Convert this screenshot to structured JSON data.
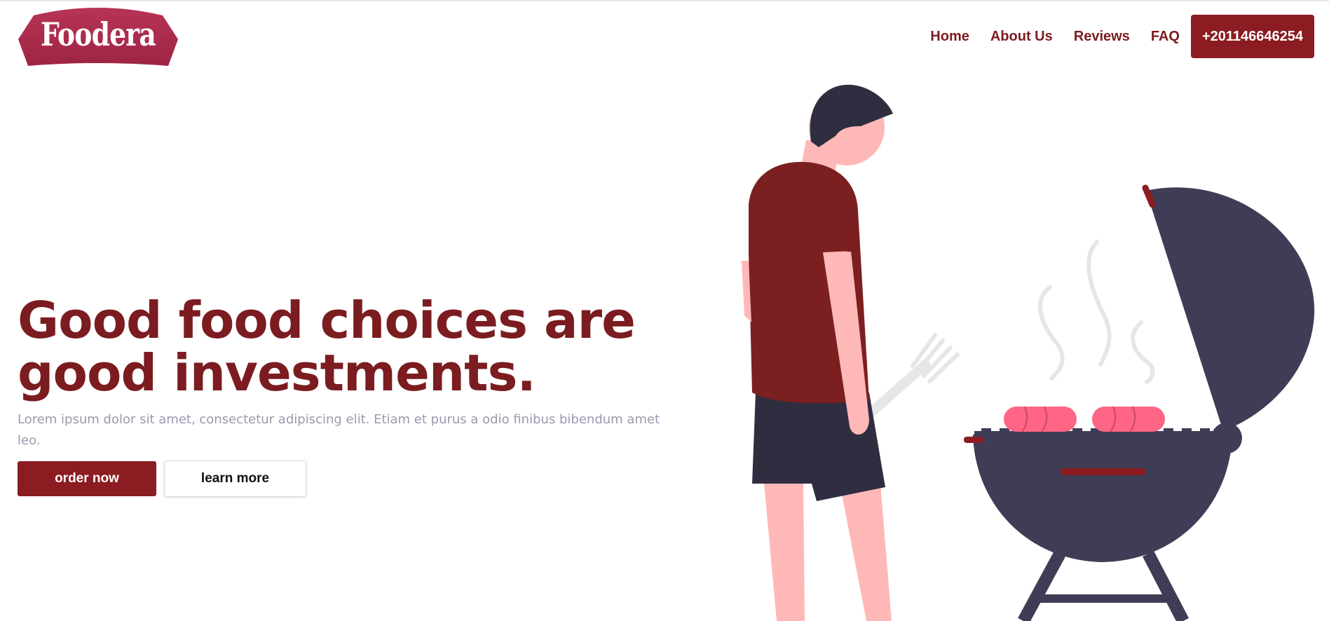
{
  "brand": {
    "name": "Foodera",
    "color": "#a82a49"
  },
  "nav": {
    "links": [
      "Home",
      "About Us",
      "Reviews",
      "FAQ"
    ],
    "phone": "+201146646254"
  },
  "hero": {
    "title": "Good food choices are good investments.",
    "subtitle": "Lorem ipsum dolor sit amet, consectetur adipiscing elit. Etiam et purus a odio finibus bibendum amet leo.",
    "primary_button": "order now",
    "secondary_button": "learn more"
  },
  "colors": {
    "accent": "#8b1c21",
    "heading": "#7b1c20",
    "muted_text": "#9a9aaf",
    "grill": "#3f3d56",
    "skin": "#ffb8b8",
    "sausage": "#ff6584"
  },
  "illustration": {
    "icon": "man-grilling-illustration"
  }
}
